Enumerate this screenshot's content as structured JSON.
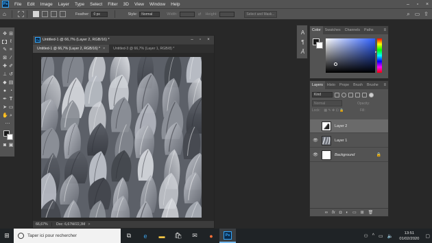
{
  "menubar": {
    "items": [
      "File",
      "Edit",
      "Image",
      "Layer",
      "Type",
      "Select",
      "Filter",
      "3D",
      "View",
      "Window",
      "Help"
    ],
    "app_logo": "Ps"
  },
  "optionsbar": {
    "feather_label": "Feather:",
    "feather_value": "0 px",
    "style_label": "Style:",
    "style_value": "Normal",
    "width_label": "Width:",
    "height_label": "Height:",
    "select_mask": "Select and Mask..."
  },
  "document": {
    "window_title": "Untitled-1 @ 66,7% (Layer 2, RGB/16) *",
    "tabs": [
      {
        "label": "Untitled-1 @ 66,7% (Layer 2, RGB/16) *",
        "active": true
      },
      {
        "label": "Untitled-3 @ 66,7% (Layer 1, RGB/8) *",
        "active": false
      }
    ],
    "status_zoom": "66,67%",
    "status_doc": "Doc: 6,67M/22,3M",
    "status_arrow": ">"
  },
  "color_panel": {
    "tabs": [
      "Color",
      "Swatches",
      "Channels",
      "Paths"
    ],
    "foreground": "#1a1a1a",
    "background": "#ffffff"
  },
  "layers_panel": {
    "tabs": [
      "Layers",
      "Histo",
      "Prope",
      "Brush",
      "Brushe"
    ],
    "filter_kind": "Kind",
    "blend_mode": "Normal",
    "opacity_label": "Opacity:",
    "lock_label": "Lock:",
    "fill_label": "Fill:",
    "layers": [
      {
        "name": "Layer 2",
        "selected": true,
        "visible": false
      },
      {
        "name": "Layer 1",
        "selected": false,
        "visible": true
      },
      {
        "name": "Background",
        "selected": false,
        "visible": true,
        "locked": true
      }
    ],
    "footer_fx": "fx"
  },
  "taskbar": {
    "search_placeholder": "Taper ici pour rechercher",
    "time": "13:51",
    "date": "01/02/2020",
    "ps_label": "Ps"
  }
}
